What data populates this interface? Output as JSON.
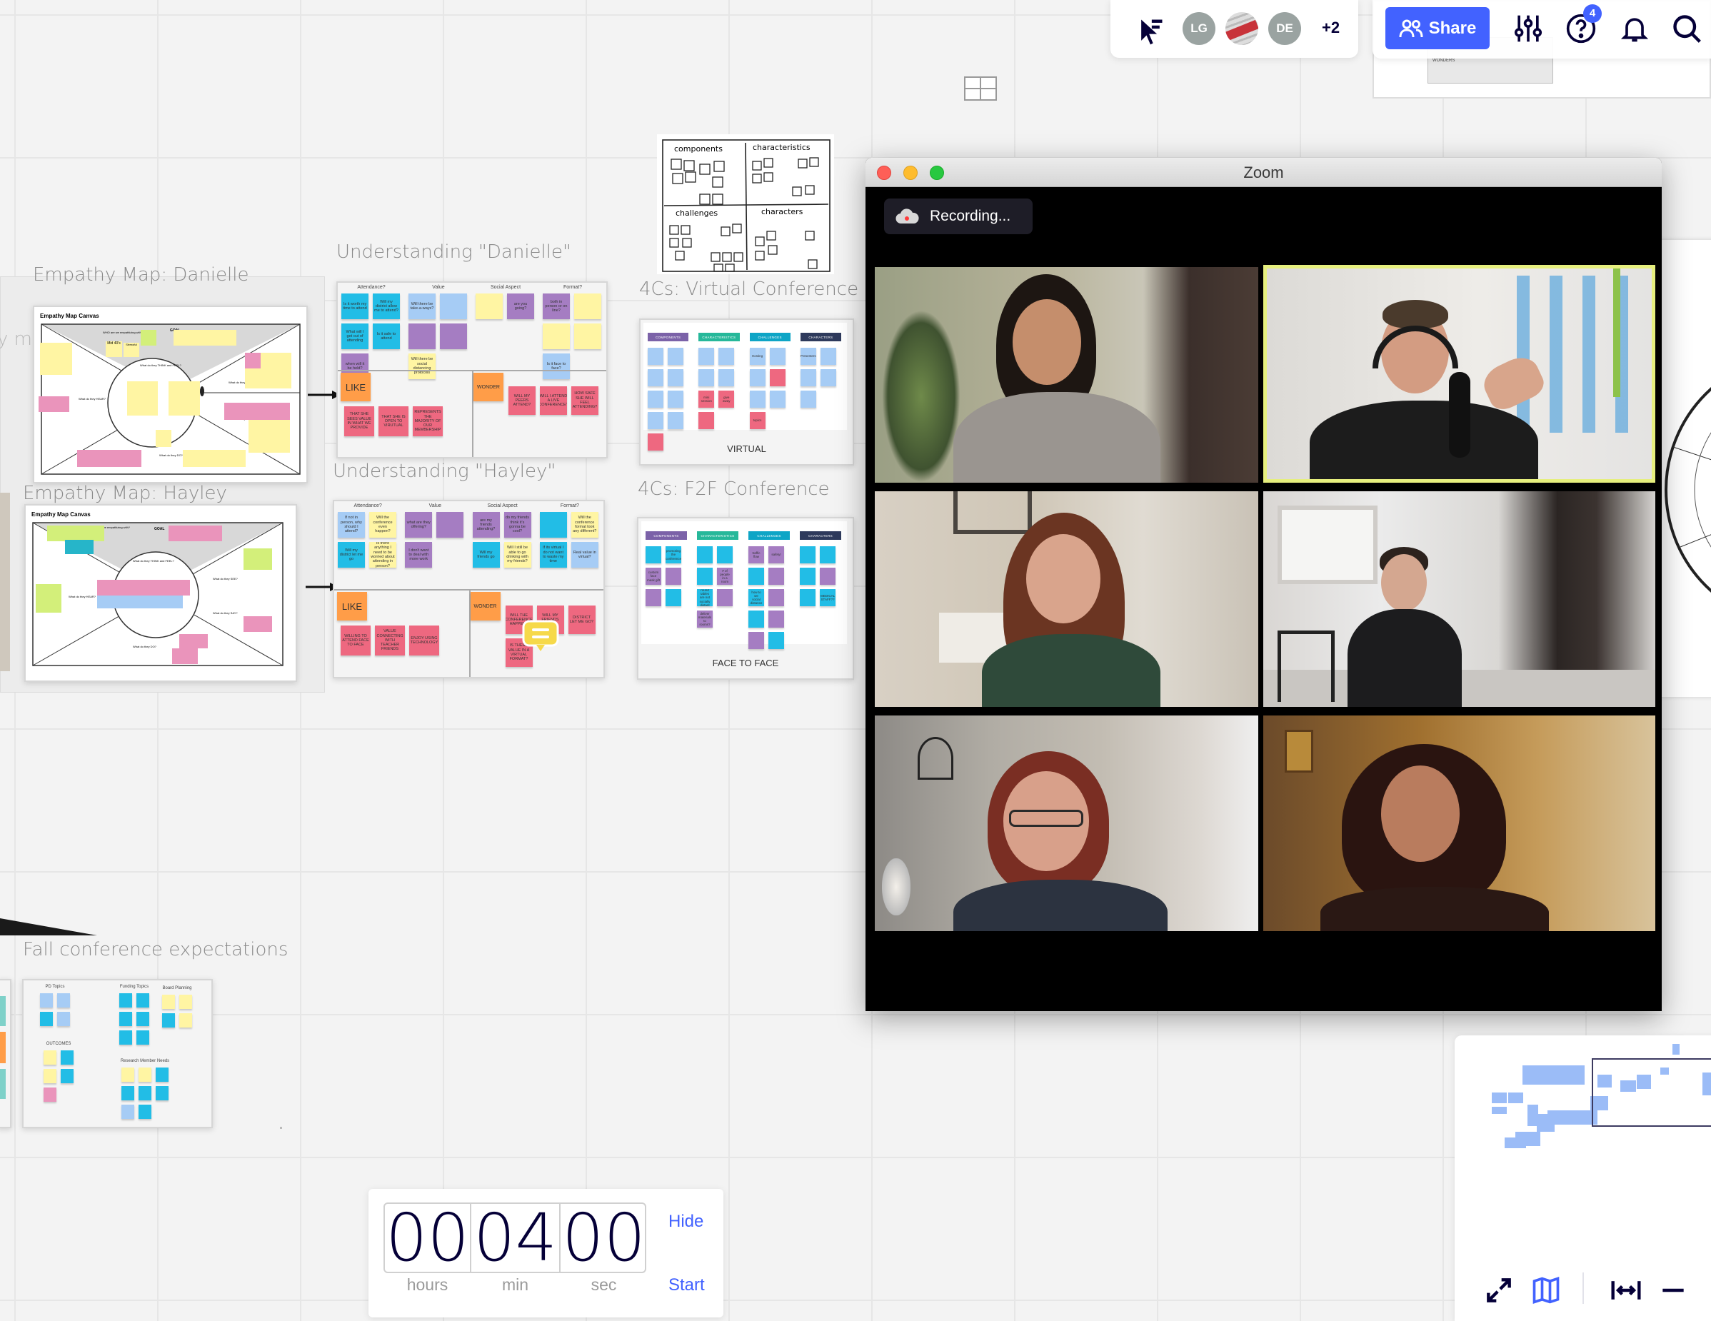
{
  "toolbar": {
    "cursor_icon": "collaborator-cursor-icon",
    "avatars": [
      {
        "initials": "LG",
        "color": "#9aa3a1"
      },
      {
        "initials": "",
        "image": "marketing-photo"
      },
      {
        "initials": "DE",
        "color": "#9aa3a1"
      }
    ],
    "more_collaborators": "+2",
    "share_label": "Share",
    "share_color": "#4262ff",
    "help_badge": "4",
    "icons": [
      "settings-sliders-icon",
      "help-icon",
      "bell-icon",
      "search-icon"
    ]
  },
  "background_board": {
    "label": "WONDERS"
  },
  "zoom_window": {
    "title": "Zoom",
    "recording_label": "Recording...",
    "active_speaker_border": "#e6ef7e"
  },
  "canvas": {
    "partial_label": "y map",
    "empathy_danielle": {
      "title": "Empathy Map: Danielle",
      "canvas_title": "Empathy Map Canvas",
      "goal": "GOAL",
      "sections": [
        "WHO are we empathizing with?",
        "What do they THINK and FEEL?",
        "What do they SEE?",
        "What do they HEAR?",
        "What do they SAY?",
        "What do they DO?"
      ],
      "notes": [
        "Mid 40's",
        "Stressful"
      ]
    },
    "empathy_hayley": {
      "title": "Empathy Map: Hayley",
      "canvas_title": "Empathy Map Canvas",
      "goal": "GOAL",
      "sections": [
        "WHO are we empathizing with?",
        "What do they THINK and FEEL?",
        "What do they SEE?",
        "What do they HEAR?",
        "What do they SAY?",
        "What do they DO?"
      ]
    },
    "understanding_danielle": {
      "title": "Understanding \"Danielle\"",
      "columns": [
        {
          "header": "Attendance?",
          "stickies": [
            {
              "text": "Is it worth my time to attend",
              "color": "cyan"
            },
            {
              "text": "Will my district allow me to attend?",
              "color": "cyan"
            },
            {
              "text": "What will I get out of attending",
              "color": "cyan"
            },
            {
              "text": "Is it safe to attend",
              "color": "cyan"
            },
            {
              "text": "when will it be held?",
              "color": "purple"
            }
          ]
        },
        {
          "header": "Value",
          "stickies": [
            {
              "text": "Will there be take-a-ways?",
              "color": "blue"
            },
            {
              "text": "",
              "color": "blue"
            },
            {
              "text": "",
              "color": "purple"
            },
            {
              "text": "",
              "color": "purple"
            },
            {
              "text": "Will there be social distancing protocols",
              "color": "yellow"
            }
          ]
        },
        {
          "header": "Social Aspect",
          "stickies": [
            {
              "text": "",
              "color": "yellow"
            },
            {
              "text": "are you going?",
              "color": "purple"
            }
          ]
        },
        {
          "header": "Format?",
          "stickies": [
            {
              "text": "both in person or on line?",
              "color": "purple"
            },
            {
              "text": "",
              "color": "yellow"
            },
            {
              "text": "",
              "color": "yellow"
            },
            {
              "text": "",
              "color": "yellow"
            },
            {
              "text": "Is it face to face?",
              "color": "blue"
            }
          ]
        }
      ],
      "like_label": "LIKE",
      "wonder_label": "WONDER",
      "like": [
        "THAT SHE SEES VALUE IN WHAT WE PROVIDE",
        "THAT SHE IS OPEN TO VIRUTUAL",
        "REPRESENTS THE MAJORITY OF OUR MEMBERSHIP"
      ],
      "wonder": [
        "WILL MY PEERS ATTEND?",
        "WILL I ATTEND A LIVE CONFERENCE?",
        "HOW SAFE SHE WILL FEEL ATTENDING?"
      ]
    },
    "understanding_hayley": {
      "title": "Understanding \"Hayley\"",
      "columns": [
        {
          "header": "Attendance?",
          "stickies": [
            {
              "text": "If not in person, why should I attend?",
              "color": "blue"
            },
            {
              "text": "Will the conference even happen?",
              "color": "yellow"
            },
            {
              "text": "Will my district let me go",
              "color": "cyan"
            },
            {
              "text": "Is there anything I need to be worried about attending in person?",
              "color": "yellow"
            }
          ]
        },
        {
          "header": "Value",
          "stickies": [
            {
              "text": "what are they offering?",
              "color": "purple"
            },
            {
              "text": "",
              "color": "purple"
            },
            {
              "text": "I don't want to deal with more work",
              "color": "purple"
            }
          ]
        },
        {
          "header": "Social Aspect",
          "stickies": [
            {
              "text": "are my friends attending?",
              "color": "purple"
            },
            {
              "text": "do my friends think it's gonna be cool?",
              "color": "purple"
            },
            {
              "text": "Will my friends go",
              "color": "cyan"
            },
            {
              "text": "Will I still be able to go drinking with my friends?",
              "color": "yellow"
            }
          ]
        },
        {
          "header": "Format?",
          "stickies": [
            {
              "text": "",
              "color": "cyan"
            },
            {
              "text": "Will the conference format look any different?",
              "color": "yellow"
            },
            {
              "text": "If its virtual I do not want to waste my time",
              "color": "cyan"
            },
            {
              "text": "Real value in virtual?",
              "color": "blue"
            }
          ]
        }
      ],
      "like_label": "LIKE",
      "wonder_label": "WONDER",
      "like": [
        "WILLING TO ATTEND FACE TO FACE",
        "VALUE CONNECTING WITH TEACHER FRIENDS",
        "ENJOY USING TECHNOLOGY"
      ],
      "wonder": [
        "WILL THE CONFERENCE HAPPEN?",
        "WILL MY FRIENDS GO?",
        "DISTRICT LET ME GO?",
        "IS THERE VALUE IN A VIRTUAL FORMAT?"
      ]
    },
    "four_cs_sketch": {
      "quadrants": [
        "components",
        "characteristics",
        "challenges",
        "characters"
      ]
    },
    "four_cs_virtual": {
      "title": "4Cs: Virtual Conference",
      "footer": "VIRTUAL",
      "columns": [
        {
          "header": "COMPONENTS",
          "color": "#7b62a8",
          "stickies": [
            {
              "text": "",
              "color": "blue"
            },
            {
              "text": "",
              "color": "blue"
            },
            {
              "text": "",
              "color": "blue"
            },
            {
              "text": "",
              "color": "blue"
            },
            {
              "text": "",
              "color": "blue"
            },
            {
              "text": "",
              "color": "blue"
            },
            {
              "text": "",
              "color": "blue"
            },
            {
              "text": "",
              "color": "blue"
            },
            {
              "text": "",
              "color": "pink"
            }
          ]
        },
        {
          "header": "CHARACTERISTICS",
          "color": "#26b89a",
          "stickies": [
            {
              "text": "",
              "color": "blue"
            },
            {
              "text": "",
              "color": "blue"
            },
            {
              "text": "",
              "color": "blue"
            },
            {
              "text": "",
              "color": "blue"
            },
            {
              "text": "mini session",
              "color": "pink"
            },
            {
              "text": "give away",
              "color": "pink"
            },
            {
              "text": "",
              "color": "pink"
            }
          ]
        },
        {
          "header": "CHALLENGES",
          "color": "#0ea5c6",
          "stickies": [
            {
              "text": "Hosting",
              "color": "blue"
            },
            {
              "text": "",
              "color": "blue"
            },
            {
              "text": "",
              "color": "blue"
            },
            {
              "text": "",
              "color": "pink"
            },
            {
              "text": "",
              "color": "blue"
            },
            {
              "text": "",
              "color": "blue"
            },
            {
              "text": "topics",
              "color": "pink"
            }
          ]
        },
        {
          "header": "CHARACTERS",
          "color": "#2e3a5c",
          "stickies": [
            {
              "text": "Presenters",
              "color": "blue"
            },
            {
              "text": "",
              "color": "blue"
            },
            {
              "text": "",
              "color": "blue"
            },
            {
              "text": "",
              "color": "blue"
            },
            {
              "text": "",
              "color": "blue"
            }
          ]
        }
      ]
    },
    "four_cs_f2f": {
      "title": "4Cs: F2F Conference",
      "footer": "FACE TO FACE",
      "columns": [
        {
          "header": "COMPONENTS",
          "color": "#7b62a8",
          "stickies": [
            {
              "text": "",
              "color": "cyan"
            },
            {
              "text": "promoting the conference",
              "color": "cyan"
            },
            {
              "text": "custom face mask gift",
              "color": "purple"
            },
            {
              "text": "",
              "color": "purple"
            },
            {
              "text": "",
              "color": "purple"
            },
            {
              "text": "",
              "color": "cyan"
            }
          ]
        },
        {
          "header": "CHARACTERISTICS",
          "color": "#26b89a",
          "stickies": [
            {
              "text": "",
              "color": "cyan"
            },
            {
              "text": "",
              "color": "cyan"
            },
            {
              "text": "",
              "color": "cyan"
            },
            {
              "text": "# of people in a room",
              "color": "purple"
            },
            {
              "text": "round tables are not socially distant",
              "color": "cyan"
            },
            {
              "text": "",
              "color": "purple"
            },
            {
              "text": "deliver materials to rooms?",
              "color": "purple"
            }
          ]
        },
        {
          "header": "CHALLENGES",
          "color": "#0ea5c6",
          "stickies": [
            {
              "text": "traffic flow",
              "color": "purple"
            },
            {
              "text": "safety!",
              "color": "purple"
            },
            {
              "text": "",
              "color": "cyan"
            },
            {
              "text": "",
              "color": "purple"
            },
            {
              "text": "how to we social distance",
              "color": "cyan"
            },
            {
              "text": "",
              "color": "purple"
            },
            {
              "text": "",
              "color": "cyan"
            },
            {
              "text": "",
              "color": "purple"
            },
            {
              "text": "",
              "color": "purple"
            },
            {
              "text": "",
              "color": "cyan"
            }
          ]
        },
        {
          "header": "CHARACTERS",
          "color": "#2e3a5c",
          "stickies": [
            {
              "text": "",
              "color": "cyan"
            },
            {
              "text": "",
              "color": "cyan"
            },
            {
              "text": "",
              "color": "cyan"
            },
            {
              "text": "",
              "color": "purple"
            },
            {
              "text": "",
              "color": "cyan"
            },
            {
              "text": "MEDICAL STAFF??",
              "color": "cyan"
            }
          ]
        }
      ]
    },
    "fall_conference": {
      "title": "Fall conference expectations",
      "sections": [
        {
          "label": "PD Topics",
          "stickies": [
            "blue",
            "blue",
            "cyan",
            "blue"
          ]
        },
        {
          "label": "Funding Topics",
          "stickies": [
            "cyan",
            "cyan",
            "cyan",
            "cyan",
            "cyan",
            "cyan"
          ]
        },
        {
          "label": "Board Planning",
          "stickies": [
            "yellow",
            "yellow",
            "cyan",
            "yellow"
          ]
        },
        {
          "label": "OUTCOMES",
          "stickies": [
            "yellow",
            "cyan",
            "yellow",
            "cyan",
            "magenta"
          ]
        },
        {
          "label": "Research Member Needs",
          "stickies": [
            "yellow",
            "yellow",
            "cyan",
            "cyan",
            "cyan",
            "cyan",
            "blue",
            "cyan"
          ]
        }
      ]
    }
  },
  "sticky_colors": {
    "cyan": "#22bde6",
    "blue": "#a6ccf5",
    "purple": "#a57dc2",
    "yellow": "#fff5a3",
    "pink": "#ee6880",
    "orange": "#ff9d48",
    "magenta": "#ea94bb",
    "green": "#d3ef7a"
  },
  "timer": {
    "hours": "00",
    "minutes": "04",
    "seconds": "00",
    "hours_label": "hours",
    "minutes_label": "min",
    "seconds_label": "sec",
    "hide_label": "Hide",
    "start_label": "Start"
  },
  "navigator": {
    "icons": [
      "fullscreen-icon",
      "map-icon",
      "fit-to-screen-icon",
      "zoom-out-icon"
    ],
    "active_icon": "map-icon"
  }
}
